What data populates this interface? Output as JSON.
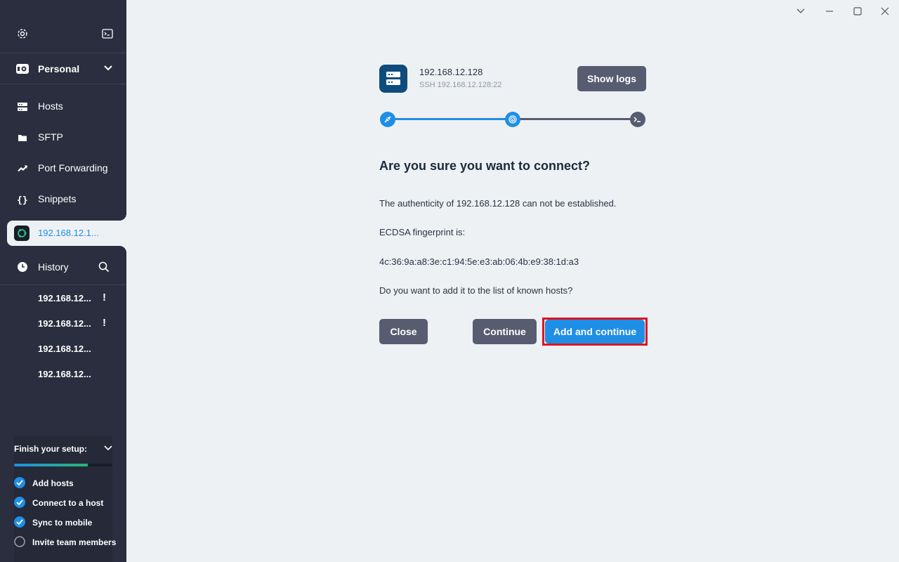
{
  "sidebar": {
    "vault_label": "Personal",
    "nav": [
      {
        "label": "Hosts",
        "icon": "hosts-icon"
      },
      {
        "label": "SFTP",
        "icon": "folder-icon"
      },
      {
        "label": "Port Forwarding",
        "icon": "port-forward-icon"
      },
      {
        "label": "Snippets",
        "icon": "braces-icon"
      }
    ],
    "active_tab_label": "192.168.12.1...",
    "history_label": "History",
    "history_items": [
      {
        "label": "192.168.12...",
        "warn": "!"
      },
      {
        "label": "192.168.12...",
        "warn": "!"
      },
      {
        "label": "192.168.12...",
        "warn": ""
      },
      {
        "label": "192.168.12...",
        "warn": ""
      }
    ],
    "setup": {
      "title": "Finish your setup:",
      "progress": 0.75,
      "items": [
        {
          "label": "Add hosts",
          "done": true
        },
        {
          "label": "Connect to a host",
          "done": true
        },
        {
          "label": "Sync to mobile",
          "done": true
        },
        {
          "label": "Invite team members",
          "done": false
        }
      ]
    }
  },
  "connection": {
    "host": "192.168.12.128",
    "subtitle": "SSH 192.168.12.128:22",
    "show_logs": "Show logs",
    "heading": "Are you sure you want to connect?",
    "line1": "The authenticity of 192.168.12.128 can not be established.",
    "line2": "ECDSA fingerprint is:",
    "fingerprint": "4c:36:9a:a8:3e:c1:94:5e:e3:ab:06:4b:e9:38:1d:a3",
    "line3": "Do you want to add it to the list of known hosts?",
    "close": "Close",
    "continue": "Continue",
    "add_continue": "Add and continue"
  },
  "colors": {
    "accent": "#1e8ee6",
    "sidebar": "#2a2e3f",
    "highlight": "#e0141e"
  }
}
